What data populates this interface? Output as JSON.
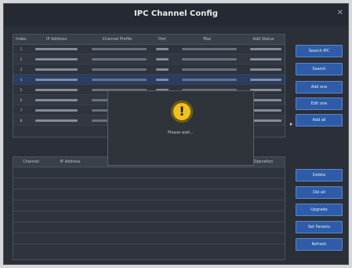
{
  "window": {
    "title": "IPC Channel Config",
    "close_icon": "close-icon"
  },
  "top_table": {
    "headers": [
      "Index",
      "IP Address",
      "Channel Profile",
      "Port",
      "Mac",
      "Add Status"
    ],
    "rows": [
      {
        "index": "1",
        "ip": "",
        "profile": "",
        "port": "",
        "mac": "",
        "status": ""
      },
      {
        "index": "2",
        "ip": "",
        "profile": "",
        "port": "",
        "mac": "",
        "status": ""
      },
      {
        "index": "3",
        "ip": "",
        "profile": "",
        "port": "",
        "mac": "",
        "status": ""
      },
      {
        "index": "4",
        "ip": "",
        "profile": "",
        "port": "",
        "mac": "",
        "status": ""
      },
      {
        "index": "5",
        "ip": "",
        "profile": "",
        "port": "",
        "mac": "",
        "status": ""
      },
      {
        "index": "6",
        "ip": "",
        "profile": "",
        "port": "",
        "mac": "",
        "status": ""
      },
      {
        "index": "7",
        "ip": "",
        "profile": "",
        "port": "",
        "mac": "",
        "status": ""
      },
      {
        "index": "8",
        "ip": "",
        "profile": "",
        "port": "",
        "mac": "",
        "status": ""
      }
    ]
  },
  "bottom_table": {
    "headers": [
      "Channel",
      "IP Address",
      "",
      "",
      "",
      "Operation"
    ]
  },
  "buttons": {
    "search": "Search IPC",
    "search2": "Search",
    "add_one": "Add one",
    "edit_one": "Edit one",
    "add_all": "Add all",
    "delete": "Delete",
    "del_all": "Del all",
    "upgrade": "Upgrade",
    "set_params": "Set Params",
    "refresh": "Refresh"
  },
  "dialog": {
    "message": "Please wait...",
    "icon": "warning-icon"
  },
  "colors": {
    "accent": "#2e5ca8",
    "window_bg": "#2b2f37",
    "dialog_icon": "#f0c21a"
  }
}
